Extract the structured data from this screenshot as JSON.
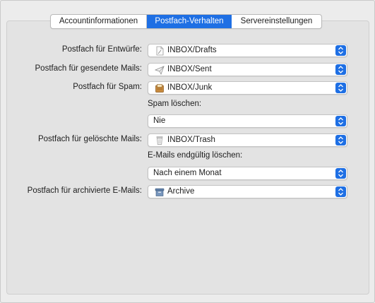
{
  "tabs": [
    {
      "label": "Accountinformationen"
    },
    {
      "label": "Postfach-Verhalten",
      "selected": true
    },
    {
      "label": "Servereinstellungen"
    }
  ],
  "accent_color": "#1e6fe4",
  "rows": {
    "drafts": {
      "label": "Postfach für Entwürfe:",
      "value": "INBOX/Drafts",
      "icon": "drafts-mailbox-icon"
    },
    "sent": {
      "label": "Postfach für gesendete Mails:",
      "value": "INBOX/Sent",
      "icon": "sent-mailbox-icon"
    },
    "spam": {
      "label": "Postfach für Spam:",
      "value": "INBOX/Junk",
      "icon": "junk-mailbox-icon"
    },
    "spam_delete": {
      "label": "Spam löschen:",
      "value": "Nie"
    },
    "trash": {
      "label": "Postfach für gelöschte Mails:",
      "value": "INBOX/Trash",
      "icon": "trash-mailbox-icon"
    },
    "trash_delete": {
      "label": "E-Mails endgültig löschen:",
      "value": "Nach einem Monat"
    },
    "archive": {
      "label": "Postfach für archivierte E-Mails:",
      "value": "Archive",
      "icon": "archive-box-icon"
    }
  }
}
